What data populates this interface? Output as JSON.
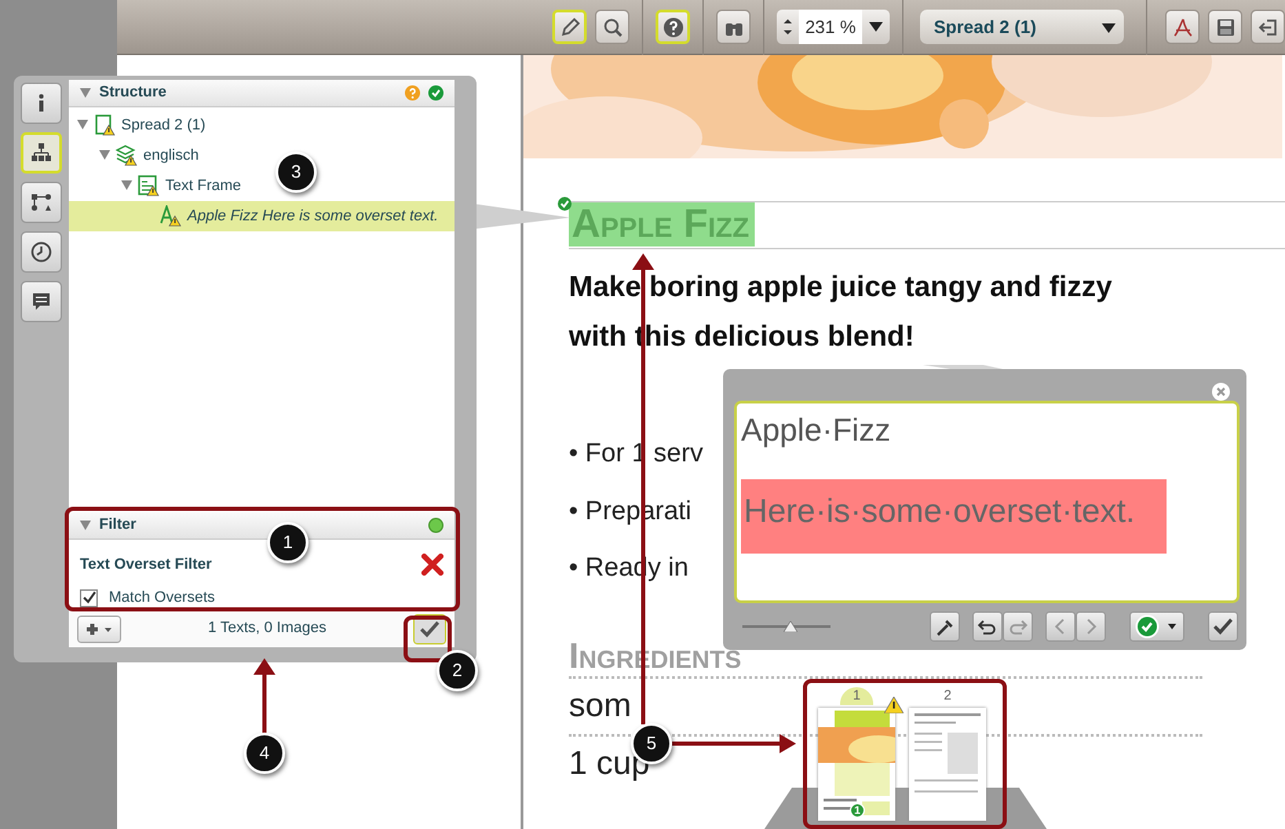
{
  "toolbar": {
    "tools": [
      {
        "kind": "pencil",
        "selected": true
      },
      {
        "kind": "search",
        "selected": false
      },
      {
        "kind": "help",
        "selected": true
      },
      {
        "kind": "binoculars",
        "selected": false
      }
    ],
    "zoom": "231 %",
    "spread": "Spread 2 (1)",
    "actions": [
      {
        "kind": "pdf"
      },
      {
        "kind": "save"
      },
      {
        "kind": "exit"
      }
    ]
  },
  "side_tabs": [
    {
      "kind": "info",
      "selected": false
    },
    {
      "kind": "structure",
      "selected": true
    },
    {
      "kind": "flow",
      "selected": false
    },
    {
      "kind": "history",
      "selected": false
    },
    {
      "kind": "comments",
      "selected": false
    }
  ],
  "structure": {
    "title": "Structure",
    "tree": [
      {
        "label": "Spread 2 (1)",
        "kind": "spread",
        "expanded": true,
        "selected": false,
        "children": [
          {
            "label": "englisch",
            "kind": "layer",
            "expanded": true,
            "selected": false,
            "children": [
              {
                "label": "Text Frame",
                "kind": "frame",
                "expanded": true,
                "selected": false,
                "children": [
                  {
                    "label": "Apple Fizz Here is some overset text.",
                    "kind": "text",
                    "selected": true
                  }
                ]
              }
            ]
          }
        ]
      }
    ]
  },
  "filter": {
    "title": "Filter",
    "name": "Text Overset Filter",
    "option": {
      "label": "Match Oversets",
      "checked": true
    },
    "result": "1 Texts, 0 Images"
  },
  "document": {
    "title": "Apple Fizz",
    "intro": "Make boring apple juice tangy and fizzy with this delicious blend!",
    "bullets": [
      "• For 1 serv",
      "• Preparati",
      "• Ready in"
    ],
    "section": "Ingredients",
    "ingredients": [
      "som",
      "1 cup"
    ]
  },
  "editor": {
    "heading": "Apple·Fizz",
    "overset": "Here·is·some·overset·text.",
    "zoom": {
      "level": 0.55
    }
  },
  "thumbnails": [
    {
      "label": "1",
      "selected": true,
      "warning": true,
      "badge": "1"
    },
    {
      "label": "2",
      "selected": false,
      "warning": false
    }
  ],
  "callouts": [
    "1",
    "2",
    "3",
    "4",
    "5"
  ]
}
